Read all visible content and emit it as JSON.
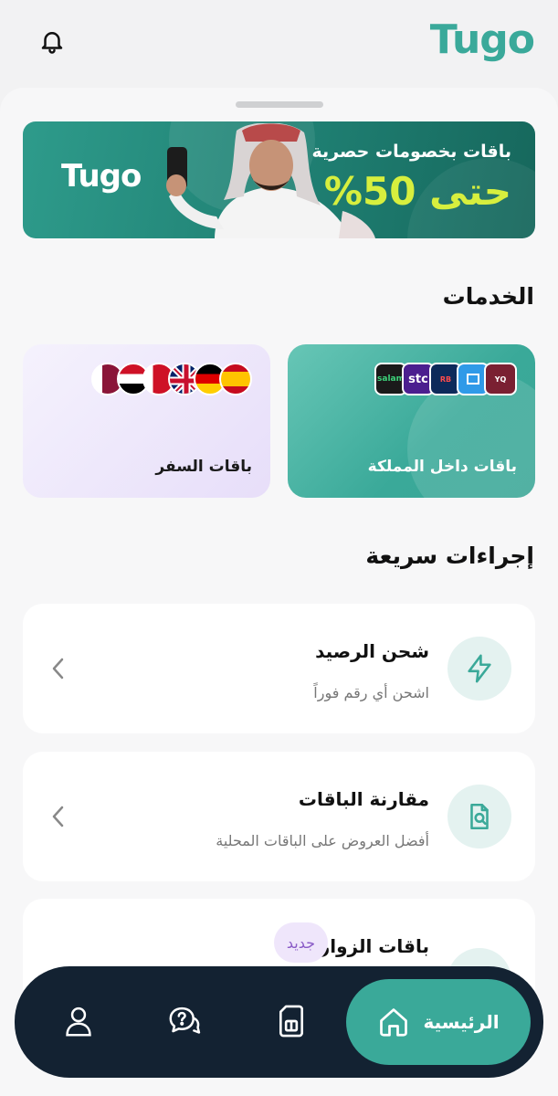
{
  "app": {
    "brand": "Tugo"
  },
  "banner": {
    "title": "باقات بخصومات حصرية",
    "discount": "حتى 50%",
    "brand": "Tugo"
  },
  "services": {
    "heading": "الخدمات",
    "domestic": {
      "label": "باقات داخل المملكة",
      "operators": [
        "Yaqoot",
        "Mobily",
        "Redbull Mobile",
        "stc",
        "salam"
      ]
    },
    "travel": {
      "label": "باقات السفر",
      "flags": [
        "Qatar",
        "Egypt",
        "Bahrain",
        "United Kingdom",
        "Germany",
        "Spain"
      ]
    }
  },
  "quick_actions": {
    "heading": "إجراءات سريعة",
    "items": [
      {
        "title": "شحن الرصيد",
        "subtitle": "اشحن أي رقم فوراً",
        "icon": "lightning-icon"
      },
      {
        "title": "مقارنة الباقات",
        "subtitle": "أفضل العروض على الباقات المحلية",
        "icon": "document-search-icon"
      },
      {
        "title": "باقات الزوار",
        "badge": "جديد",
        "icon": "globe-icon"
      }
    ]
  },
  "nav": {
    "home_label": "الرئيسية",
    "items": [
      "profile-icon",
      "support-icon",
      "sim-card-icon",
      "home-icon"
    ]
  },
  "colors": {
    "accent": "#3aa999",
    "nav_bg": "#132232",
    "discount": "#d7ef3e",
    "badge_bg": "#efe6fb",
    "badge_text": "#8a5bc7"
  }
}
